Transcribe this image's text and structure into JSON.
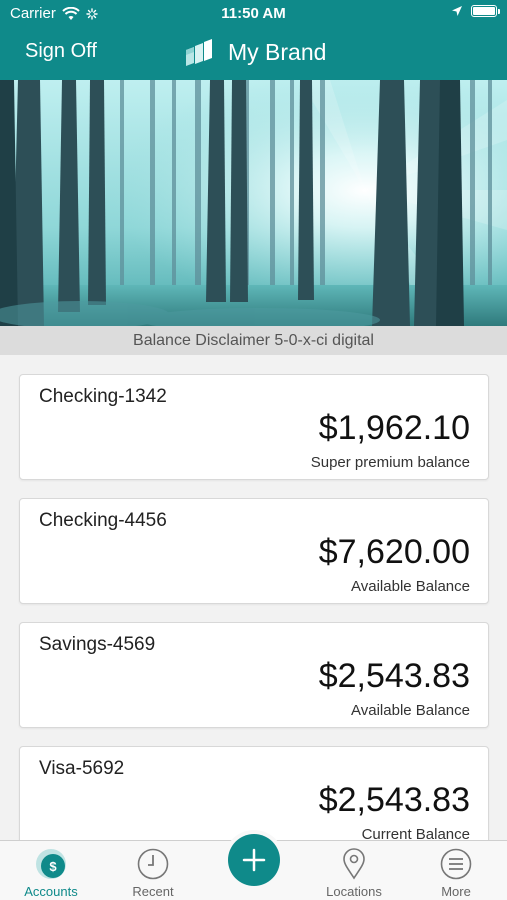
{
  "status_bar": {
    "carrier": "Carrier",
    "time": "11:50 AM",
    "battery_level": 1.0,
    "icons": [
      "wifi-icon",
      "loading-spinner-icon",
      "location-arrow-icon",
      "battery-icon"
    ]
  },
  "nav": {
    "sign_off": "Sign Off",
    "brand_name": "My Brand",
    "logo_icon": "brand-logo-icon"
  },
  "hero": {
    "image": "forest-sunlight-image"
  },
  "disclaimer": "Balance Disclaimer 5-0-x-ci digital",
  "accounts": [
    {
      "name": "Checking-1342",
      "amount": "$1,962.10",
      "label": "Super premium balance"
    },
    {
      "name": "Checking-4456",
      "amount": "$7,620.00",
      "label": "Available Balance"
    },
    {
      "name": "Savings-4569",
      "amount": "$2,543.83",
      "label": "Available Balance"
    },
    {
      "name": "Visa-5692",
      "amount": "$2,543.83",
      "label": "Current Balance"
    }
  ],
  "tabs": [
    {
      "label": "Accounts",
      "icon": "dollar-coin-icon",
      "active": true
    },
    {
      "label": "Recent",
      "icon": "clock-icon",
      "active": false
    },
    {
      "label": "Locations",
      "icon": "map-pin-icon",
      "active": false
    },
    {
      "label": "More",
      "icon": "menu-icon",
      "active": false
    }
  ],
  "fab": {
    "icon": "plus-icon"
  },
  "colors": {
    "brand": "#0f8a8a",
    "tab_inactive": "#666666",
    "background": "#f2f2f2"
  }
}
